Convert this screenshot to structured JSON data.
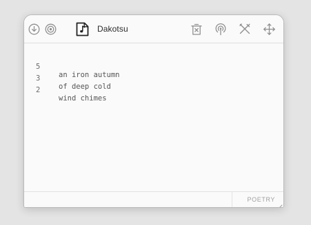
{
  "window": {
    "title": "Dakotsu",
    "icons": {
      "left": [
        "download-icon",
        "target-icon"
      ],
      "file": "music-file-icon",
      "right": [
        "trash-icon",
        "broadcast-icon",
        "tools-icon",
        "move-icon"
      ]
    }
  },
  "editor": {
    "lines": [
      {
        "count": "5",
        "text": "an iron autumn"
      },
      {
        "count": "3",
        "text": "of deep cold"
      },
      {
        "count": "2",
        "text": "wind chimes"
      }
    ]
  },
  "status": {
    "mode": "POETRY"
  },
  "colors": {
    "background": "#e4e4e4",
    "window": "#fafafa",
    "icon": "#8f8f8f",
    "text": "#555555"
  }
}
